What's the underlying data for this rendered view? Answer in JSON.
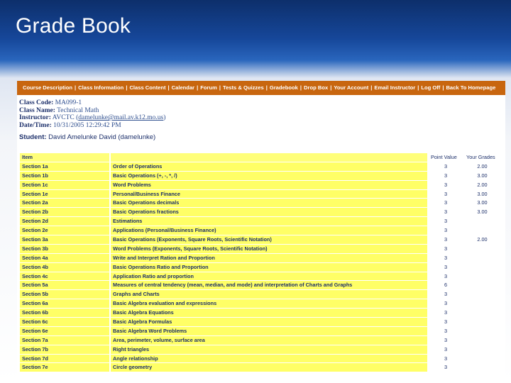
{
  "slide": {
    "title": "Grade Book"
  },
  "nav": {
    "links": [
      "Course Description",
      "Class Information",
      "Class Content",
      "Calendar",
      "Forum",
      "Tests & Quizzes",
      "Gradebook",
      "Drop Box",
      "Your Account",
      "Email Instructor",
      "Log Off",
      "Back To Homepage"
    ],
    "separator": "|"
  },
  "class_info": {
    "code_label": "Class Code:",
    "code": "MA099-1",
    "name_label": "Class Name:",
    "name": "Technical Math",
    "instructor_label": "Instructor:",
    "instructor": "AVCTC",
    "instructor_email": "damelunke@mail.av.k12.mo.us",
    "datetime_label": "Date/Time:",
    "datetime": "10/31/2005 12:29:42 PM",
    "student_label": "Student:",
    "student": "David Amelunke David (damelunke)"
  },
  "table": {
    "headers": {
      "item": "Item",
      "title": "",
      "point_value": "Point Value",
      "grade": "Your Grades"
    },
    "rows": [
      [
        "Section 1a",
        "Order of Operations",
        "3",
        "2.00"
      ],
      [
        "Section 1b",
        "Basic Operations (+, -, *, /)",
        "3",
        "3.00"
      ],
      [
        "Section 1c",
        "Word Problems",
        "3",
        "2.00"
      ],
      [
        "Section 1e",
        "Personal/Business Finance",
        "3",
        "3.00"
      ],
      [
        "Section 2a",
        "Basic Operations decimals",
        "3",
        "3.00"
      ],
      [
        "Section 2b",
        "Basic Operations fractions",
        "3",
        "3.00"
      ],
      [
        "Section 2d",
        "Estimations",
        "3",
        ""
      ],
      [
        "Section 2e",
        "Applications (Personal/Business Finance)",
        "3",
        ""
      ],
      [
        "Section 3a",
        "Basic Operations (Exponents, Square Roots, Scientific Notation)",
        "3",
        "2.00"
      ],
      [
        "Section 3b",
        "Word Problems (Exponents, Square Roots, Scientific Notation)",
        "3",
        ""
      ],
      [
        "Section 4a",
        "Write and Interpret Ration and Proportion",
        "3",
        ""
      ],
      [
        "Section 4b",
        "Basic Operations Ratio and Proportion",
        "3",
        ""
      ],
      [
        "Section 4c",
        "Application Ratio and proportion",
        "3",
        ""
      ],
      [
        "Section 5a",
        "Measures of central tendency (mean, median, and mode) and interpretation of Charts and Graphs",
        "6",
        ""
      ],
      [
        "Section 5b",
        "Graphs and Charts",
        "3",
        ""
      ],
      [
        "Section 6a",
        "Basic Algebra evaluation and expressions",
        "3",
        ""
      ],
      [
        "Section 6b",
        "Basic Algebra Equations",
        "3",
        ""
      ],
      [
        "Section 6c",
        "Basic Algebra Formulas",
        "3",
        ""
      ],
      [
        "Section 6e",
        "Basic Algebra Word Problems",
        "3",
        ""
      ],
      [
        "Section 7a",
        "Area, perimeter, volume, surface area",
        "3",
        ""
      ],
      [
        "Section 7b",
        "Right triangles",
        "3",
        ""
      ],
      [
        "Section 7d",
        "Angle relationship",
        "3",
        ""
      ],
      [
        "Section 7e",
        "Circle geometry",
        "3",
        ""
      ]
    ]
  },
  "colors": {
    "nav_bg": "#c8660f",
    "row_highlight": "#ffff66",
    "header_bg": "#ffff7a",
    "text": "#1c2f6a"
  }
}
